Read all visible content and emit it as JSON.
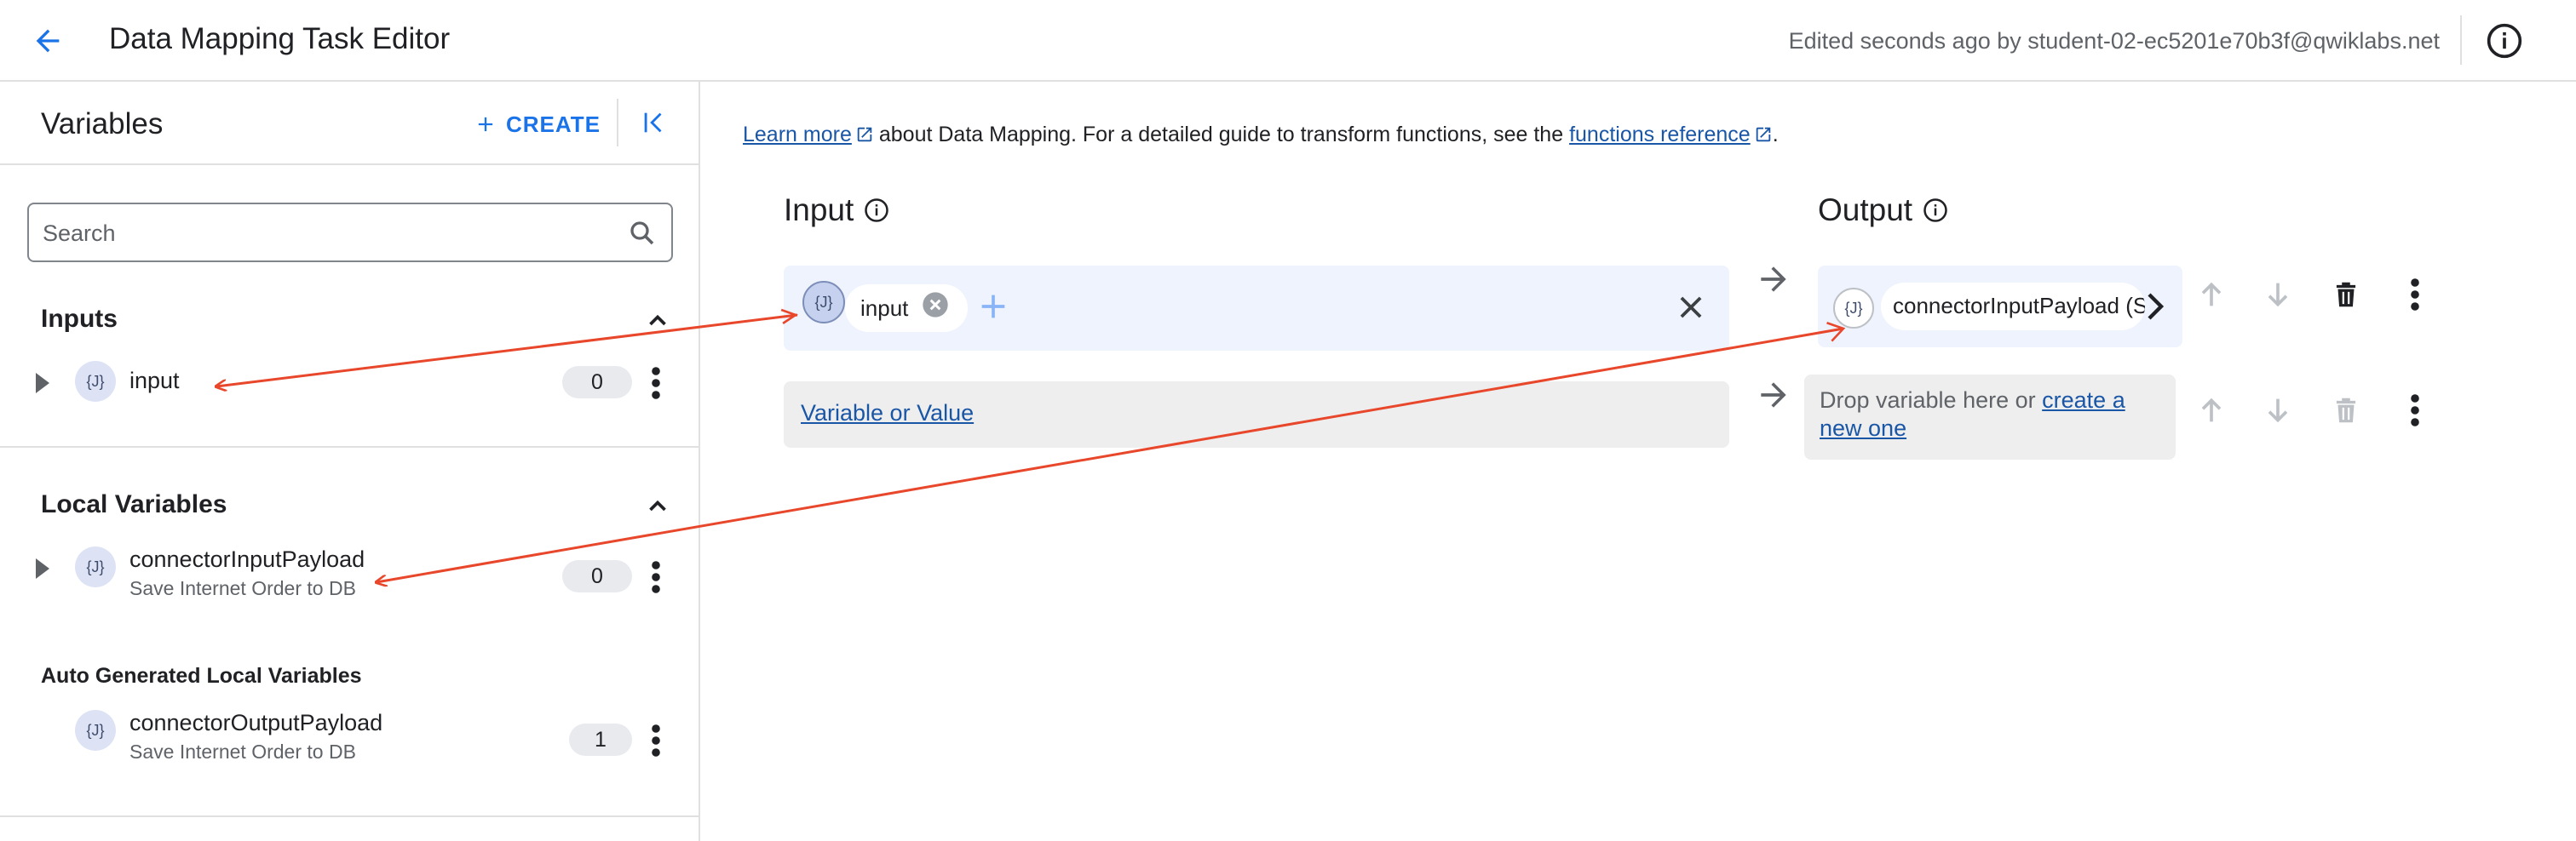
{
  "header": {
    "title": "Data Mapping Task Editor",
    "edited_text": "Edited seconds ago by student-02-ec5201e70b3f@qwiklabs.net"
  },
  "sidebar": {
    "title": "Variables",
    "create_label": "CREATE",
    "search_placeholder": "Search",
    "sections": {
      "inputs": {
        "title": "Inputs",
        "items": [
          {
            "badge": "{J}",
            "name": "input",
            "count": "0"
          }
        ]
      },
      "local": {
        "title": "Local Variables",
        "items": [
          {
            "badge": "{J}",
            "name": "connectorInputPayload",
            "subtitle": "Save Internet Order to DB",
            "count": "0"
          }
        ]
      },
      "auto": {
        "title": "Auto Generated Local Variables",
        "items": [
          {
            "badge": "{J}",
            "name": "connectorOutputPayload",
            "subtitle": "Save Internet Order to DB",
            "count": "1"
          }
        ]
      }
    }
  },
  "main": {
    "info_line": {
      "learn_more": "Learn more",
      "middle": "about Data Mapping. For a detailed guide to transform functions, see the",
      "functions_link": "functions reference",
      "end": "."
    },
    "input_title": "Input",
    "output_title": "Output",
    "rows": [
      {
        "input_badge": "{J}",
        "input_chip": "input",
        "output_badge": "{J}",
        "output_chip": "connectorInputPayload (Save Internet Order to DB)"
      },
      {
        "input_placeholder_link": "Variable or Value",
        "output_text": "Drop variable here or",
        "output_link": "create a new one"
      }
    ]
  },
  "colors": {
    "accent": "#1a73e8",
    "link": "#1a56a6",
    "annotation": "#e8472b",
    "input_row_bg": "#eef3fd",
    "empty_row_bg": "#eeeeee"
  },
  "icons": [
    "back-arrow-icon",
    "info-icon",
    "plus-icon",
    "collapse-panel-icon",
    "search-icon",
    "chevron-up-icon",
    "expand-arrow-icon",
    "more-vert-icon",
    "external-link-icon",
    "close-icon",
    "arrow-right-icon",
    "arrow-up-icon",
    "arrow-down-icon",
    "delete-icon",
    "chevron-right-icon"
  ]
}
